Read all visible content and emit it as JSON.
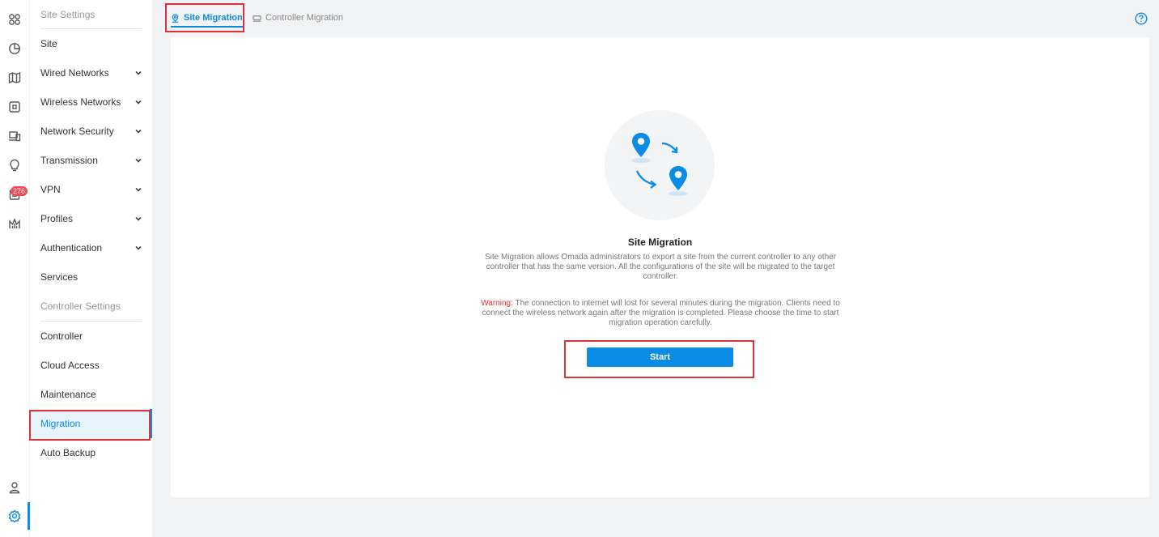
{
  "rail": {
    "notification_badge": "276",
    "icons": [
      "dashboard-icon",
      "statistics-icon",
      "map-icon",
      "devices-icon",
      "clients-icon",
      "insights-icon",
      "logs-icon",
      "reports-icon",
      "account-icon",
      "settings-icon"
    ]
  },
  "sidebar": {
    "site_settings_heading": "Site Settings",
    "items": [
      {
        "label": "Site"
      },
      {
        "label": "Wired Networks"
      },
      {
        "label": "Wireless Networks"
      },
      {
        "label": "Network Security"
      },
      {
        "label": "Transmission"
      },
      {
        "label": "VPN"
      },
      {
        "label": "Profiles"
      },
      {
        "label": "Authentication"
      },
      {
        "label": "Services"
      }
    ],
    "controller_settings_heading": "Controller Settings",
    "controller_items": [
      {
        "label": "Controller"
      },
      {
        "label": "Cloud Access"
      },
      {
        "label": "Maintenance"
      },
      {
        "label": "Migration"
      },
      {
        "label": "Auto Backup"
      }
    ]
  },
  "tabs": [
    {
      "label": "Site Migration",
      "active": true
    },
    {
      "label": "Controller Migration",
      "active": false
    }
  ],
  "main": {
    "title": "Site Migration",
    "description": "Site Migration allows Omada administrators to export a site from the current controller to any other controller that has the same version. All the configurations of the site will be migrated to the target controller.",
    "warning_label": "Warning:",
    "warning_text": " The connection to internet will lost for several minutes during the migration. Clients need to connect the wireless network again after the migration is completed. Please choose the time to start migration operation carefully.",
    "start_button": "Start"
  },
  "colors": {
    "accent": "#0a8be6",
    "warning": "#e0303a",
    "highlight_box": "#e0303a"
  }
}
